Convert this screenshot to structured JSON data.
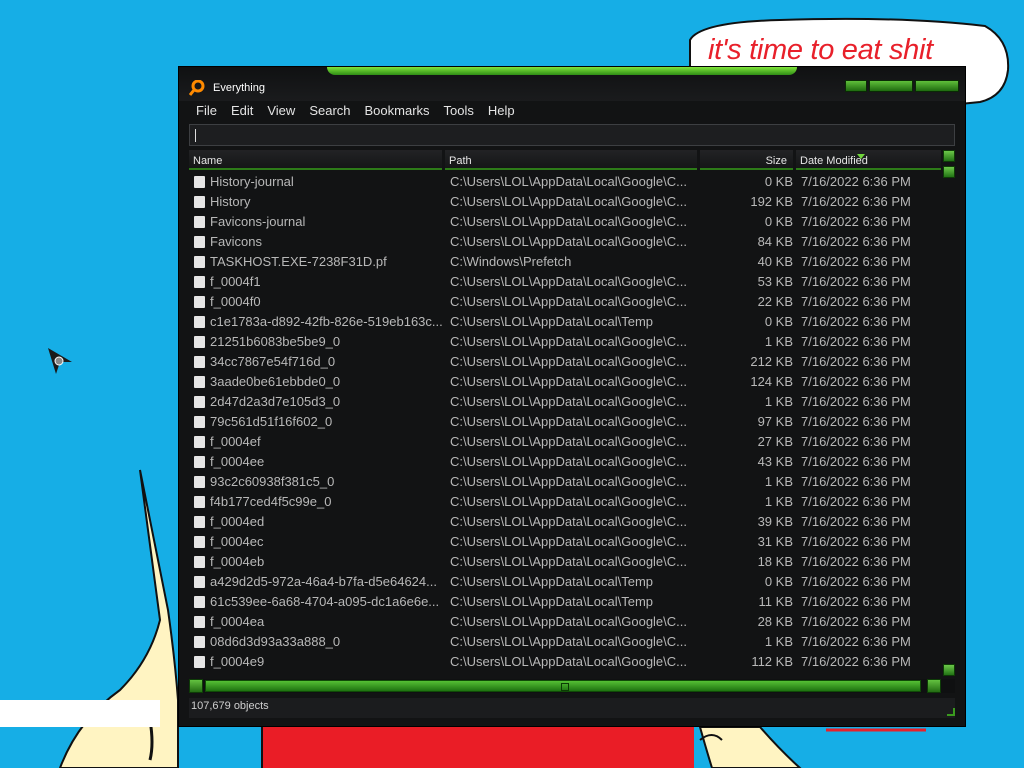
{
  "desktop": {
    "speech_text": "it's time to eat shit",
    "speech_color": "#e8202a",
    "background_color": "#16aee6"
  },
  "window": {
    "title": "Everything",
    "accent_color": "#3ba51f",
    "menu": [
      "File",
      "Edit",
      "View",
      "Search",
      "Bookmarks",
      "Tools",
      "Help"
    ],
    "search": {
      "value": "",
      "placeholder": ""
    },
    "columns": {
      "name": "Name",
      "path": "Path",
      "size": "Size",
      "date": "Date Modified"
    },
    "sort": {
      "column": "Date Modified",
      "direction": "descending"
    },
    "rows": [
      {
        "name": "History-journal",
        "path": "C:\\Users\\LOL\\AppData\\Local\\Google\\C...",
        "size": "0 KB",
        "date": "7/16/2022 6:36 PM"
      },
      {
        "name": "History",
        "path": "C:\\Users\\LOL\\AppData\\Local\\Google\\C...",
        "size": "192 KB",
        "date": "7/16/2022 6:36 PM"
      },
      {
        "name": "Favicons-journal",
        "path": "C:\\Users\\LOL\\AppData\\Local\\Google\\C...",
        "size": "0 KB",
        "date": "7/16/2022 6:36 PM"
      },
      {
        "name": "Favicons",
        "path": "C:\\Users\\LOL\\AppData\\Local\\Google\\C...",
        "size": "84 KB",
        "date": "7/16/2022 6:36 PM"
      },
      {
        "name": "TASKHOST.EXE-7238F31D.pf",
        "path": "C:\\Windows\\Prefetch",
        "size": "40 KB",
        "date": "7/16/2022 6:36 PM"
      },
      {
        "name": "f_0004f1",
        "path": "C:\\Users\\LOL\\AppData\\Local\\Google\\C...",
        "size": "53 KB",
        "date": "7/16/2022 6:36 PM"
      },
      {
        "name": "f_0004f0",
        "path": "C:\\Users\\LOL\\AppData\\Local\\Google\\C...",
        "size": "22 KB",
        "date": "7/16/2022 6:36 PM"
      },
      {
        "name": "c1e1783a-d892-42fb-826e-519eb163c...",
        "path": "C:\\Users\\LOL\\AppData\\Local\\Temp",
        "size": "0 KB",
        "date": "7/16/2022 6:36 PM"
      },
      {
        "name": "21251b6083be5be9_0",
        "path": "C:\\Users\\LOL\\AppData\\Local\\Google\\C...",
        "size": "1 KB",
        "date": "7/16/2022 6:36 PM"
      },
      {
        "name": "34cc7867e54f716d_0",
        "path": "C:\\Users\\LOL\\AppData\\Local\\Google\\C...",
        "size": "212 KB",
        "date": "7/16/2022 6:36 PM"
      },
      {
        "name": "3aade0be61ebbde0_0",
        "path": "C:\\Users\\LOL\\AppData\\Local\\Google\\C...",
        "size": "124 KB",
        "date": "7/16/2022 6:36 PM"
      },
      {
        "name": "2d47d2a3d7e105d3_0",
        "path": "C:\\Users\\LOL\\AppData\\Local\\Google\\C...",
        "size": "1 KB",
        "date": "7/16/2022 6:36 PM"
      },
      {
        "name": "79c561d51f16f602_0",
        "path": "C:\\Users\\LOL\\AppData\\Local\\Google\\C...",
        "size": "97 KB",
        "date": "7/16/2022 6:36 PM"
      },
      {
        "name": "f_0004ef",
        "path": "C:\\Users\\LOL\\AppData\\Local\\Google\\C...",
        "size": "27 KB",
        "date": "7/16/2022 6:36 PM"
      },
      {
        "name": "f_0004ee",
        "path": "C:\\Users\\LOL\\AppData\\Local\\Google\\C...",
        "size": "43 KB",
        "date": "7/16/2022 6:36 PM"
      },
      {
        "name": "93c2c60938f381c5_0",
        "path": "C:\\Users\\LOL\\AppData\\Local\\Google\\C...",
        "size": "1 KB",
        "date": "7/16/2022 6:36 PM"
      },
      {
        "name": "f4b177ced4f5c99e_0",
        "path": "C:\\Users\\LOL\\AppData\\Local\\Google\\C...",
        "size": "1 KB",
        "date": "7/16/2022 6:36 PM"
      },
      {
        "name": "f_0004ed",
        "path": "C:\\Users\\LOL\\AppData\\Local\\Google\\C...",
        "size": "39 KB",
        "date": "7/16/2022 6:36 PM"
      },
      {
        "name": "f_0004ec",
        "path": "C:\\Users\\LOL\\AppData\\Local\\Google\\C...",
        "size": "31 KB",
        "date": "7/16/2022 6:36 PM"
      },
      {
        "name": "f_0004eb",
        "path": "C:\\Users\\LOL\\AppData\\Local\\Google\\C...",
        "size": "18 KB",
        "date": "7/16/2022 6:36 PM"
      },
      {
        "name": "a429d2d5-972a-46a4-b7fa-d5e64624...",
        "path": "C:\\Users\\LOL\\AppData\\Local\\Temp",
        "size": "0 KB",
        "date": "7/16/2022 6:36 PM"
      },
      {
        "name": "61c539ee-6a68-4704-a095-dc1a6e6e...",
        "path": "C:\\Users\\LOL\\AppData\\Local\\Temp",
        "size": "11 KB",
        "date": "7/16/2022 6:36 PM"
      },
      {
        "name": "f_0004ea",
        "path": "C:\\Users\\LOL\\AppData\\Local\\Google\\C...",
        "size": "28 KB",
        "date": "7/16/2022 6:36 PM"
      },
      {
        "name": "08d6d3d93a33a888_0",
        "path": "C:\\Users\\LOL\\AppData\\Local\\Google\\C...",
        "size": "1 KB",
        "date": "7/16/2022 6:36 PM"
      },
      {
        "name": "f_0004e9",
        "path": "C:\\Users\\LOL\\AppData\\Local\\Google\\C...",
        "size": "112 KB",
        "date": "7/16/2022 6:36 PM"
      }
    ],
    "status": "107,679 objects",
    "icons": [
      "search-app-icon",
      "file-icon",
      "minimize-icon",
      "maximize-icon",
      "close-icon",
      "cursor-icon"
    ]
  }
}
